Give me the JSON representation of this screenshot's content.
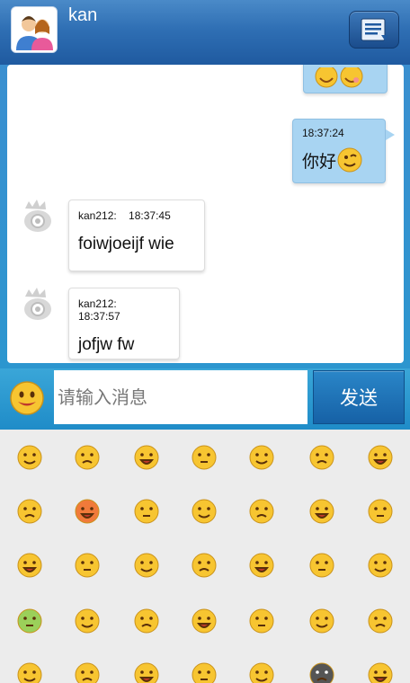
{
  "header": {
    "title": "kan"
  },
  "messages": [
    {
      "side": "self",
      "time": "18:37:24",
      "text": "你好"
    },
    {
      "side": "other",
      "sender": "kan212:",
      "time": "18:37:45",
      "text": "foiwjoeijf wie"
    },
    {
      "side": "other",
      "sender": "kan212:",
      "time": "18:37:57",
      "text": "jofjw fw"
    }
  ],
  "input": {
    "placeholder": "请输入消息",
    "send_label": "发送"
  },
  "colors": {
    "header": "#2f6fb4",
    "self_bubble": "#a8d4f2",
    "input_bar": "#1f8cc8",
    "emoji_yellow": "#f7c531"
  },
  "emoji_panel": {
    "rows": [
      [
        "smile-icon",
        "sleepy-icon",
        "laugh-open-icon",
        "angry-shout-icon",
        "shocked-icon",
        "grin-teeth-icon",
        "halo-icon"
      ],
      [
        "sad-icon",
        "furious-icon",
        "blush-icon",
        "cute-eyes-icon",
        "heart-eyes-icon",
        "money-eyes-icon",
        "wink-icon"
      ],
      [
        "smug-icon",
        "worried-icon",
        "neutral-icon",
        "grimace-icon",
        "cover-mouth-icon",
        "kiss-icon",
        "crying-icon"
      ],
      [
        "sick-icon",
        "tired-icon",
        "surprised-icon",
        "sleeping-icon",
        "question-icon",
        "annoyed-icon",
        "dizzy-icon"
      ],
      [
        "cool-icon",
        "scared-icon",
        "confused-icon",
        "glasses-icon",
        "shy-icon",
        "skull-icon",
        "scream-icon"
      ]
    ]
  }
}
